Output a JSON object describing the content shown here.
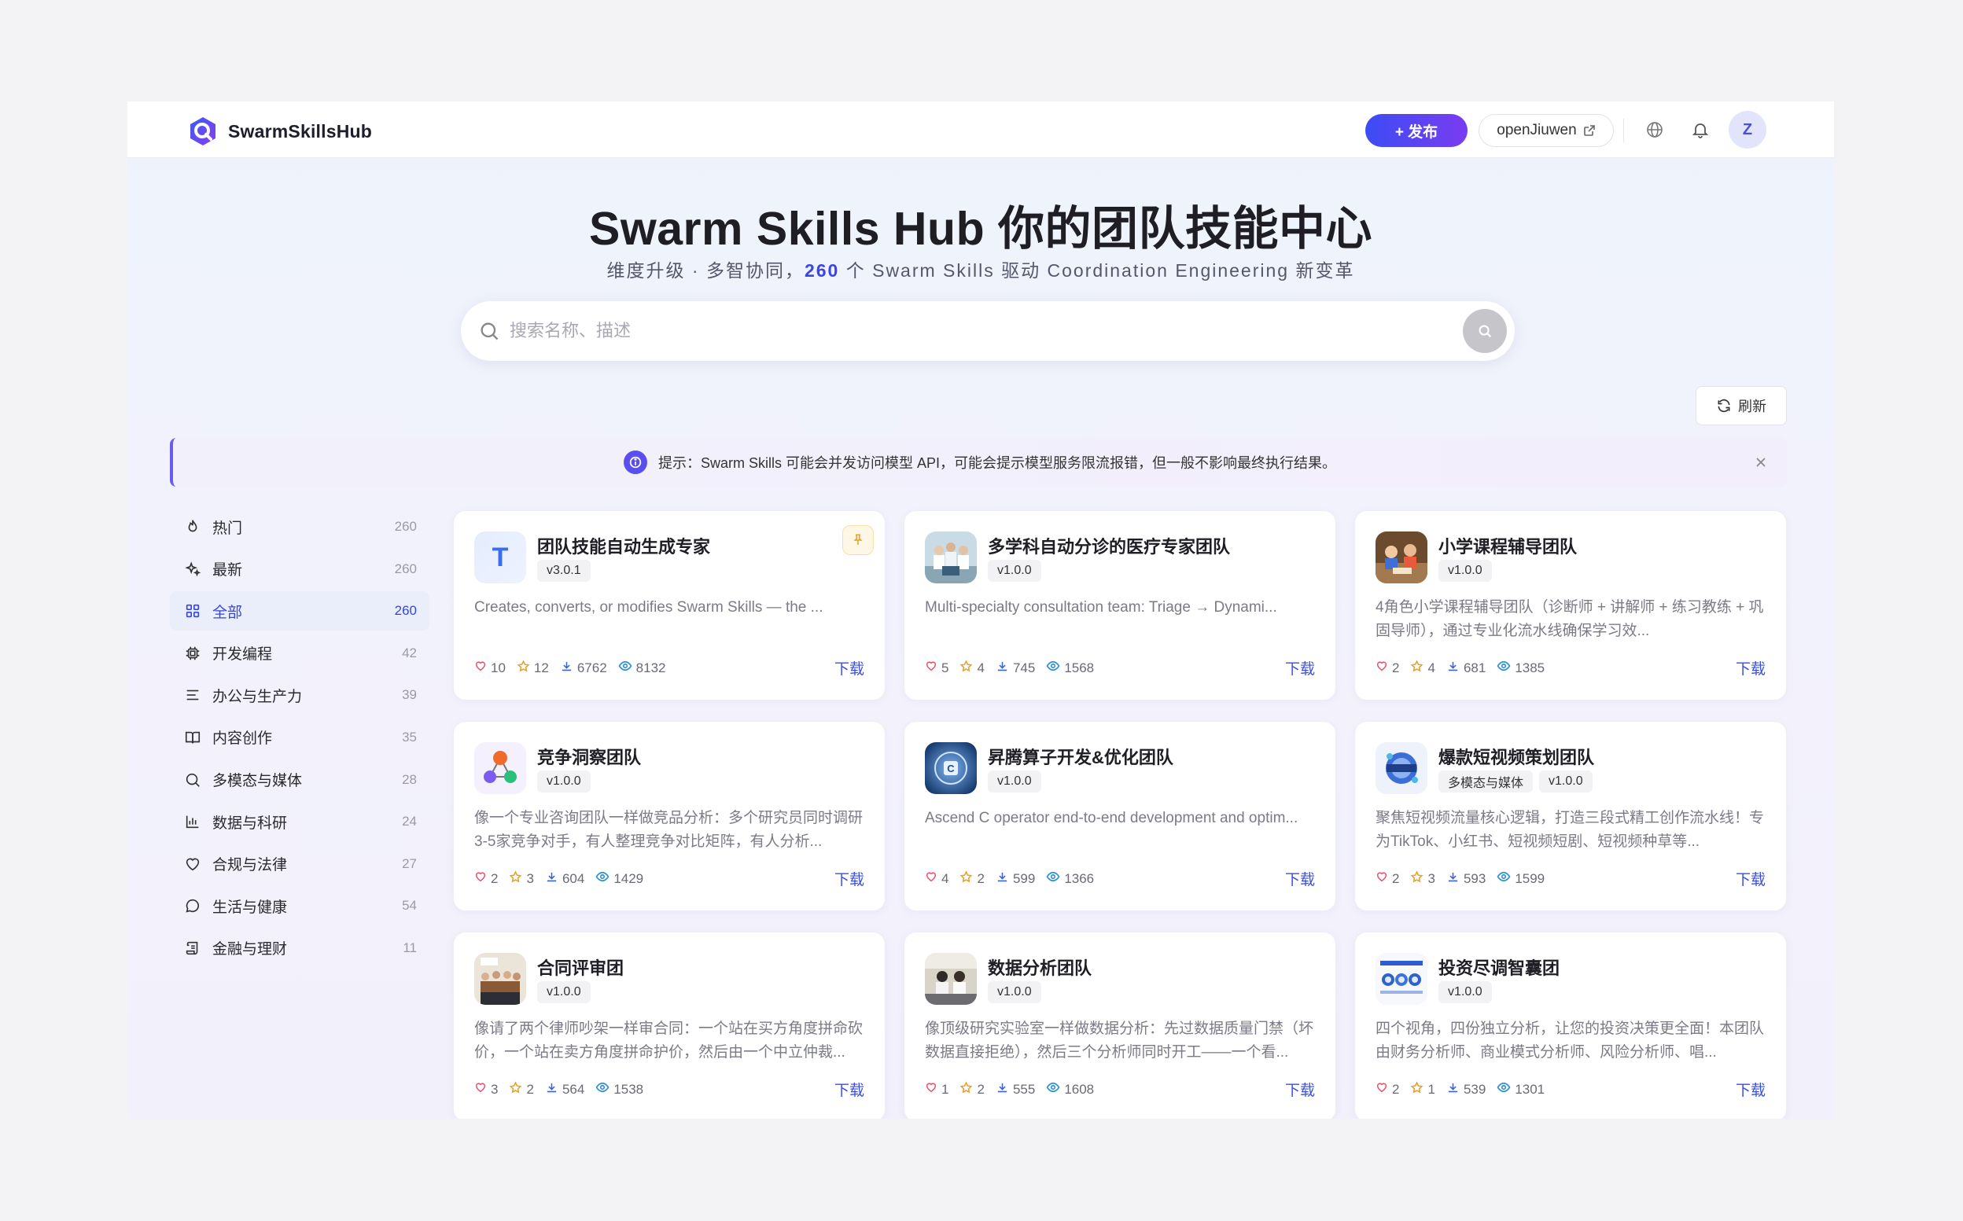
{
  "header": {
    "logo_text": "SwarmSkillsHub",
    "publish_label": "+ 发布",
    "external_link_label": "openJiuwen",
    "avatar_letter": "Z"
  },
  "hero": {
    "title": "Swarm Skills Hub 你的团队技能中心",
    "sub_prefix": "维度升级 · 多智协同，",
    "sub_count": "260",
    "sub_suffix": " 个 Swarm Skills 驱动 Coordination Engineering 新变革"
  },
  "search": {
    "placeholder": "搜索名称、描述"
  },
  "refresh_label": "刷新",
  "notice": {
    "text": "提示：Swarm Skills 可能会并发访问模型 API，可能会提示模型服务限流报错，但一般不影响最终执行结果。"
  },
  "categories": [
    {
      "label": "热门",
      "count": "260",
      "icon": "fire-icon"
    },
    {
      "label": "最新",
      "count": "260",
      "icon": "sparkle-icon"
    },
    {
      "label": "全部",
      "count": "260",
      "icon": "grid-icon",
      "active": true
    },
    {
      "label": "开发编程",
      "count": "42",
      "icon": "chip-icon"
    },
    {
      "label": "办公与生产力",
      "count": "39",
      "icon": "lines-icon"
    },
    {
      "label": "内容创作",
      "count": "35",
      "icon": "book-icon"
    },
    {
      "label": "多模态与媒体",
      "count": "28",
      "icon": "search-icon"
    },
    {
      "label": "数据与科研",
      "count": "24",
      "icon": "bar-chart-icon"
    },
    {
      "label": "合规与法律",
      "count": "27",
      "icon": "heart-icon"
    },
    {
      "label": "生活与健康",
      "count": "54",
      "icon": "chat-bubble-icon"
    },
    {
      "label": "金融与理财",
      "count": "11",
      "icon": "scroll-icon"
    }
  ],
  "cards": [
    {
      "title": "团队技能自动生成专家",
      "tags": [
        "v3.0.1"
      ],
      "desc": "Creates, converts, or modifies Swarm Skills — the ...",
      "likes": "10",
      "stars": "12",
      "downloads": "6762",
      "views": "8132",
      "download_label": "下载",
      "thumb": "letter",
      "thumb_letter": "T",
      "pinned": true
    },
    {
      "title": "多学科自动分诊的医疗专家团队",
      "tags": [
        "v1.0.0"
      ],
      "desc": "Multi-specialty consultation team: Triage → Dynami...",
      "likes": "5",
      "stars": "4",
      "downloads": "745",
      "views": "1568",
      "download_label": "下载",
      "thumb": "medical-photo"
    },
    {
      "title": "小学课程辅导团队",
      "tags": [
        "v1.0.0"
      ],
      "desc": "4角色小学课程辅导团队（诊断师 + 讲解师 + 练习教练 + 巩固导师），通过专业化流水线确保学习效...",
      "likes": "2",
      "stars": "4",
      "downloads": "681",
      "views": "1385",
      "download_label": "下载",
      "thumb": "classroom-photo"
    },
    {
      "title": "竞争洞察团队",
      "tags": [
        "v1.0.0"
      ],
      "desc": "像一个专业咨询团队一样做竞品分析：多个研究员同时调研3-5家竞争对手，有人整理竞争对比矩阵，有人分析...",
      "likes": "2",
      "stars": "3",
      "downloads": "604",
      "views": "1429",
      "download_label": "下载",
      "thumb": "nodes"
    },
    {
      "title": "昇腾算子开发&优化团队",
      "tags": [
        "v1.0.0"
      ],
      "desc": "Ascend C operator end-to-end development and optim...",
      "likes": "4",
      "stars": "2",
      "downloads": "599",
      "views": "1366",
      "download_label": "下载",
      "thumb": "chip-photo"
    },
    {
      "title": "爆款短视频策划团队",
      "tags": [
        "多模态与媒体",
        "v1.0.0"
      ],
      "desc": "聚焦短视频流量核心逻辑，打造三段式精工创作流水线！专为TikTok、小红书、短视频短剧、短视频种草等...",
      "likes": "2",
      "stars": "3",
      "downloads": "593",
      "views": "1599",
      "download_label": "下载",
      "thumb": "video-photo"
    },
    {
      "title": "合同评审团",
      "tags": [
        "v1.0.0"
      ],
      "desc": "像请了两个律师吵架一样审合同：一个站在买方角度拼命砍价，一个站在卖方角度拼命护价，然后由一个中立仲裁...",
      "likes": "3",
      "stars": "2",
      "downloads": "564",
      "views": "1538",
      "download_label": "下载",
      "thumb": "meeting-photo"
    },
    {
      "title": "数据分析团队",
      "tags": [
        "v1.0.0"
      ],
      "desc": "像顶级研究实验室一样做数据分析：先过数据质量门禁（坏数据直接拒绝），然后三个分析师同时开工——一个看...",
      "likes": "1",
      "stars": "2",
      "downloads": "555",
      "views": "1608",
      "download_label": "下载",
      "thumb": "lab-photo"
    },
    {
      "title": "投资尽调智囊团",
      "tags": [
        "v1.0.0"
      ],
      "desc": "四个视角，四份独立分析，让您的投资决策更全面！本团队由财务分析师、商业模式分析师、风险分析师、唱...",
      "likes": "2",
      "stars": "1",
      "downloads": "539",
      "views": "1301",
      "download_label": "下载",
      "thumb": "invest-photo"
    }
  ]
}
